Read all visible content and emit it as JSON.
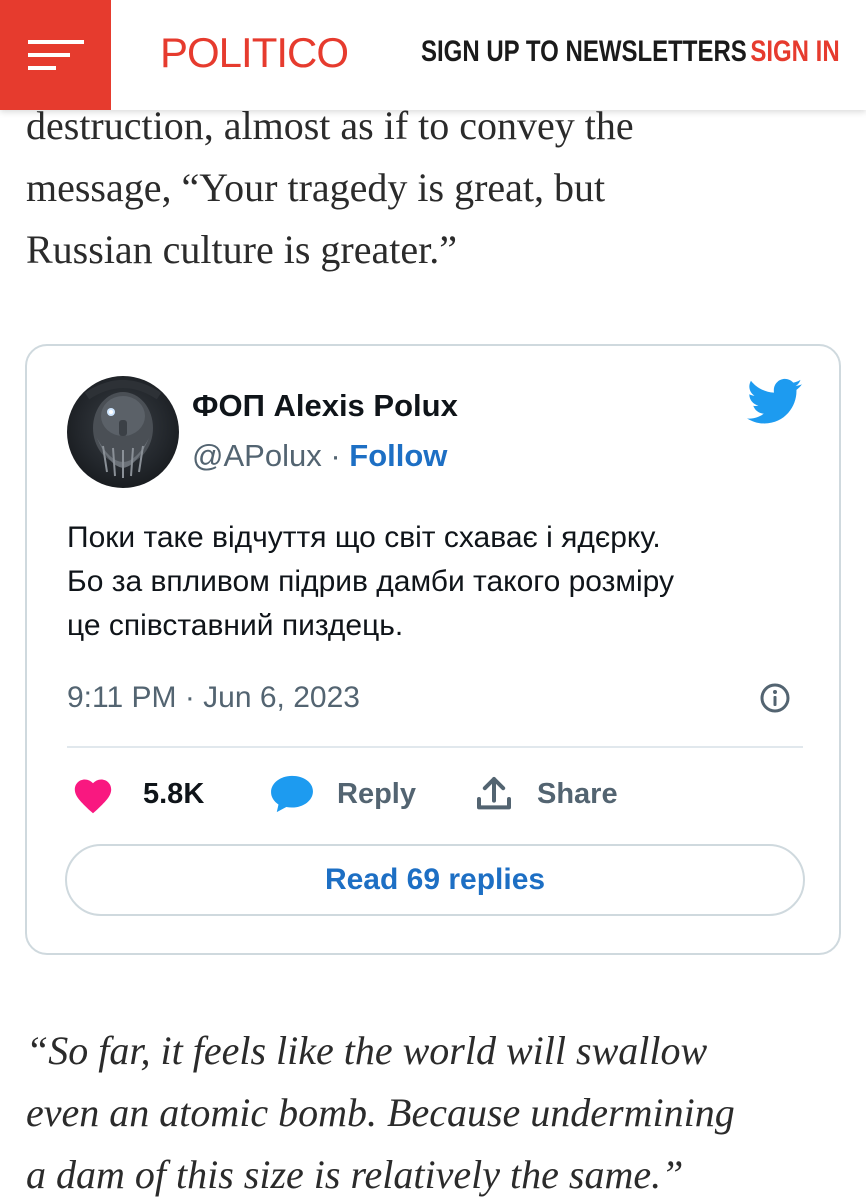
{
  "header": {
    "logo_text": "POLITICO",
    "newsletters_label": "SIGN UP TO NEWSLETTERS",
    "signin_label": "SIGN IN",
    "menu_icon": "hamburger-menu-icon",
    "brand_color": "#e63b2e"
  },
  "article": {
    "paragraph_lines": [
      "destruction, almost as if to convey the",
      "message, “Your tragedy is great, but",
      "Russian culture is greater.”"
    ],
    "quote_lines": [
      "“So far, it feels like the world will swallow",
      "even an atomic bomb. Because undermining",
      "a dam of this size is relatively the same.”"
    ]
  },
  "tweet": {
    "display_name": "ФОП Alexis Polux",
    "handle": "@APolux",
    "separator": " · ",
    "follow_label": "Follow",
    "text": "Поки таке відчуття що світ схаває і ядєрку.\nБо за впливом підрив дамби такого розміру\nце співставний пиздець.",
    "timestamp": "9:11 PM · Jun 6, 2023",
    "likes_count": "5.8K",
    "reply_label": "Reply",
    "share_label": "Share",
    "read_replies_label": "Read 69 replies",
    "colors": {
      "twitter_blue": "#1d9bf0",
      "link_blue": "#1d6fc4",
      "like_pink": "#f91880",
      "muted": "#536471"
    }
  }
}
